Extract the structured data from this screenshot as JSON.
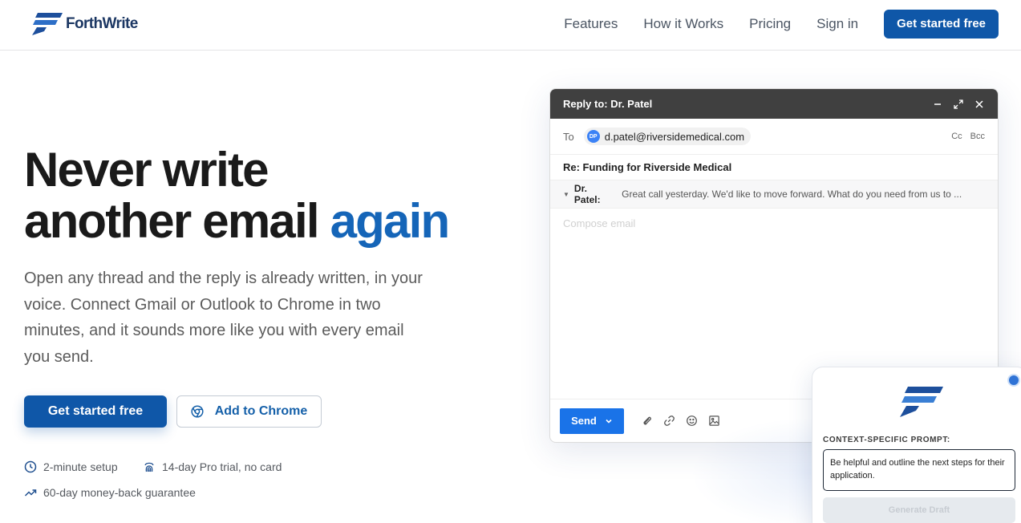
{
  "nav": {
    "brand_name": "ForthWrite",
    "links": [
      "Features",
      "How it Works",
      "Pricing",
      "Sign in"
    ],
    "cta_label": "Get started free"
  },
  "hero": {
    "title_line1": "Never write",
    "title_line2_plain": "another email",
    "title_line2_accent": "again",
    "subtitle": "Open any thread and the reply is already written, in your voice. Connect Gmail or Outlook to Chrome in two minutes, and it sounds more like you with every email you send.",
    "primary_cta": "Get started free",
    "secondary_cta": "Add to Chrome",
    "perks": [
      {
        "icon": "clock-icon",
        "text": "2-minute setup"
      },
      {
        "icon": "fingerprint-icon",
        "text": "14-day Pro trial, no card"
      },
      {
        "icon": "trending-up-icon",
        "text": "60-day money-back guarantee"
      }
    ]
  },
  "compose": {
    "header_title": "Reply to: Dr. Patel",
    "to_label": "To",
    "recipient_initials": "DP",
    "recipient_email": "d.patel@riversidemedical.com",
    "cc_label": "Cc",
    "bcc_label": "Bcc",
    "subject": "Re: Funding for Riverside Medical",
    "quoted_sender": "Dr. Patel:",
    "quoted_message": "Great call yesterday. We'd like to move forward. What do you need from us to ...",
    "body_placeholder": "Compose email",
    "send_label": "Send"
  },
  "extension": {
    "prompt_label": "CONTEXT-SPECIFIC PROMPT:",
    "prompt_value": "Be helpful and outline the next steps for their application.",
    "generate_label": "Generate Draft"
  },
  "colors": {
    "brand_blue": "#0f57a8",
    "accent_blue": "#1565b8",
    "send_blue": "#1a73e8",
    "compose_header": "#404040"
  }
}
